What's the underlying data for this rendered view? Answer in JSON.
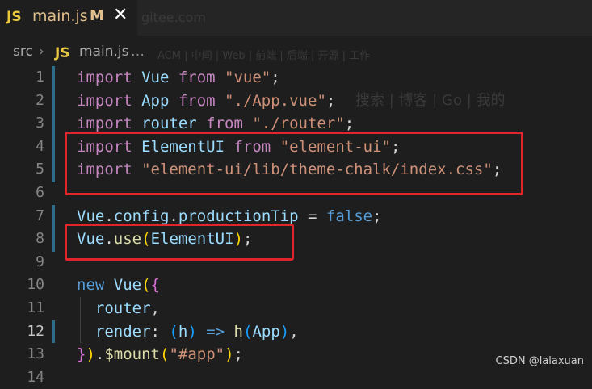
{
  "tab": {
    "badge": "JS",
    "name": "main.js",
    "status": "M",
    "close": "✕"
  },
  "breadcrumb": {
    "folder": "src",
    "separator": "›",
    "badge": "JS",
    "file": "main.js",
    "more": "…"
  },
  "ghost": {
    "top": "gitee.com",
    "bar": "ACM | 中间 | Web | 前端 | 后端 | 开源 | 工作",
    "nav": "搜索 | 博客 | Go | 我的"
  },
  "lines": [
    {
      "n": "1"
    },
    {
      "n": "2"
    },
    {
      "n": "3"
    },
    {
      "n": "4"
    },
    {
      "n": "5"
    },
    {
      "n": "6"
    },
    {
      "n": "7"
    },
    {
      "n": "8"
    },
    {
      "n": "9"
    },
    {
      "n": "10"
    },
    {
      "n": "11"
    },
    {
      "n": "12"
    },
    {
      "n": "13"
    },
    {
      "n": "14"
    }
  ],
  "code": {
    "l1": {
      "kw": "import",
      "id": " Vue ",
      "from": "from",
      "str": " \"vue\"",
      "end": ";"
    },
    "l2": {
      "kw": "import",
      "id": " App ",
      "from": "from",
      "str": " \"./App.vue\"",
      "end": ";"
    },
    "l3": {
      "kw": "import",
      "id": " router ",
      "from": "from",
      "str": " \"./router\"",
      "end": ";"
    },
    "l4": {
      "kw": "import",
      "id": " ElementUI ",
      "from": "from",
      "str": " \"element-ui\"",
      "end": ";"
    },
    "l5": {
      "kw": "import",
      "str": " \"element-ui/lib/theme-chalk/index.css\"",
      "end": ";"
    },
    "l7": {
      "a": "Vue",
      "b": ".",
      "c": "config",
      "d": ".",
      "e": "productionTip",
      "f": " = ",
      "g": "false",
      "h": ";"
    },
    "l8": {
      "a": "Vue",
      "b": ".",
      "c": "use",
      "d": "(",
      "e": "ElementUI",
      "f": ")",
      "g": ";"
    },
    "l10": {
      "a": "new",
      "b": " Vue",
      "c": "(",
      "d": "{"
    },
    "l11": {
      "a": "  router",
      "b": ","
    },
    "l12": {
      "a": "  render",
      "b": ": ",
      "c": "(",
      "d": "h",
      "e": ")",
      "f": " => ",
      "g": "h",
      "h": "(",
      "i": "App",
      "j": ")",
      "k": ","
    },
    "l13": {
      "a": "}",
      "b": ")",
      "c": ".",
      "d": "$mount",
      "e": "(",
      "f": "\"#app\"",
      "g": ")",
      "h": ";"
    }
  },
  "watermark": "CSDN @lalaxuan"
}
